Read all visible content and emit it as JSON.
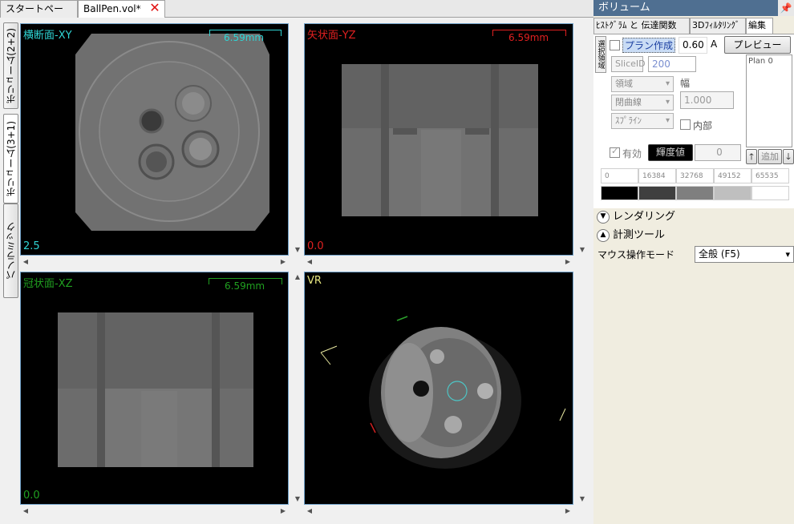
{
  "tabs": {
    "start": "スタートページ",
    "active": "BallPen.vol*",
    "close_glyph": "✕"
  },
  "layout_tabs": [
    "ボリューム(2+2)",
    "ボリューム(3+1)",
    "パノラミック"
  ],
  "views": [
    {
      "title": "横断面-XY",
      "value": "2.5",
      "scale": "6.59mm",
      "color": "#2fd5d5"
    },
    {
      "title": "矢状面-YZ",
      "value": "0.0",
      "scale": "6.59mm",
      "color": "#e02020"
    },
    {
      "title": "冠状面-XZ",
      "value": "0.0",
      "scale": "6.59mm",
      "color": "#20a020"
    },
    {
      "title": "VR",
      "value": "",
      "scale": "",
      "color": "#e8e880"
    }
  ],
  "panel": {
    "header": "ボリューム",
    "pin": "📌",
    "tabs": [
      "ﾋｽﾄｸﾞﾗﾑ と 伝達関数",
      "3Dﾌｨﾙﾀﾘﾝｸﾞ",
      "編集"
    ],
    "edit": {
      "side_label": "選択領域",
      "plan_create": "プラン作成",
      "opacity": "0.60",
      "a_label": "A",
      "preview": "プレビュー",
      "slice_id_label": "SliceID",
      "slice_id": "200",
      "region": "領域",
      "closed_curve": "閉曲線",
      "spline": "ｽﾌﾟﾗｲﾝ",
      "width_label": "幅",
      "width_value": "1.000",
      "inner": "内部",
      "enabled": "有効",
      "brightness_btn": "輝度値",
      "brightness_value": "0",
      "list_items": [
        "Plan 0"
      ],
      "add": "追加",
      "up": "🡑",
      "down": "🡓",
      "gray_values": [
        "0",
        "16384",
        "32768",
        "49152",
        "65535"
      ],
      "gray_colors": [
        "#000000",
        "#3f3f3f",
        "#7f7f7f",
        "#bfbfbf",
        "#ffffff"
      ]
    },
    "rendering": "レンダリング",
    "measure": "計測ツール",
    "mouse_mode_label": "マウス操作モード",
    "mouse_mode": "全般 (F5)"
  }
}
